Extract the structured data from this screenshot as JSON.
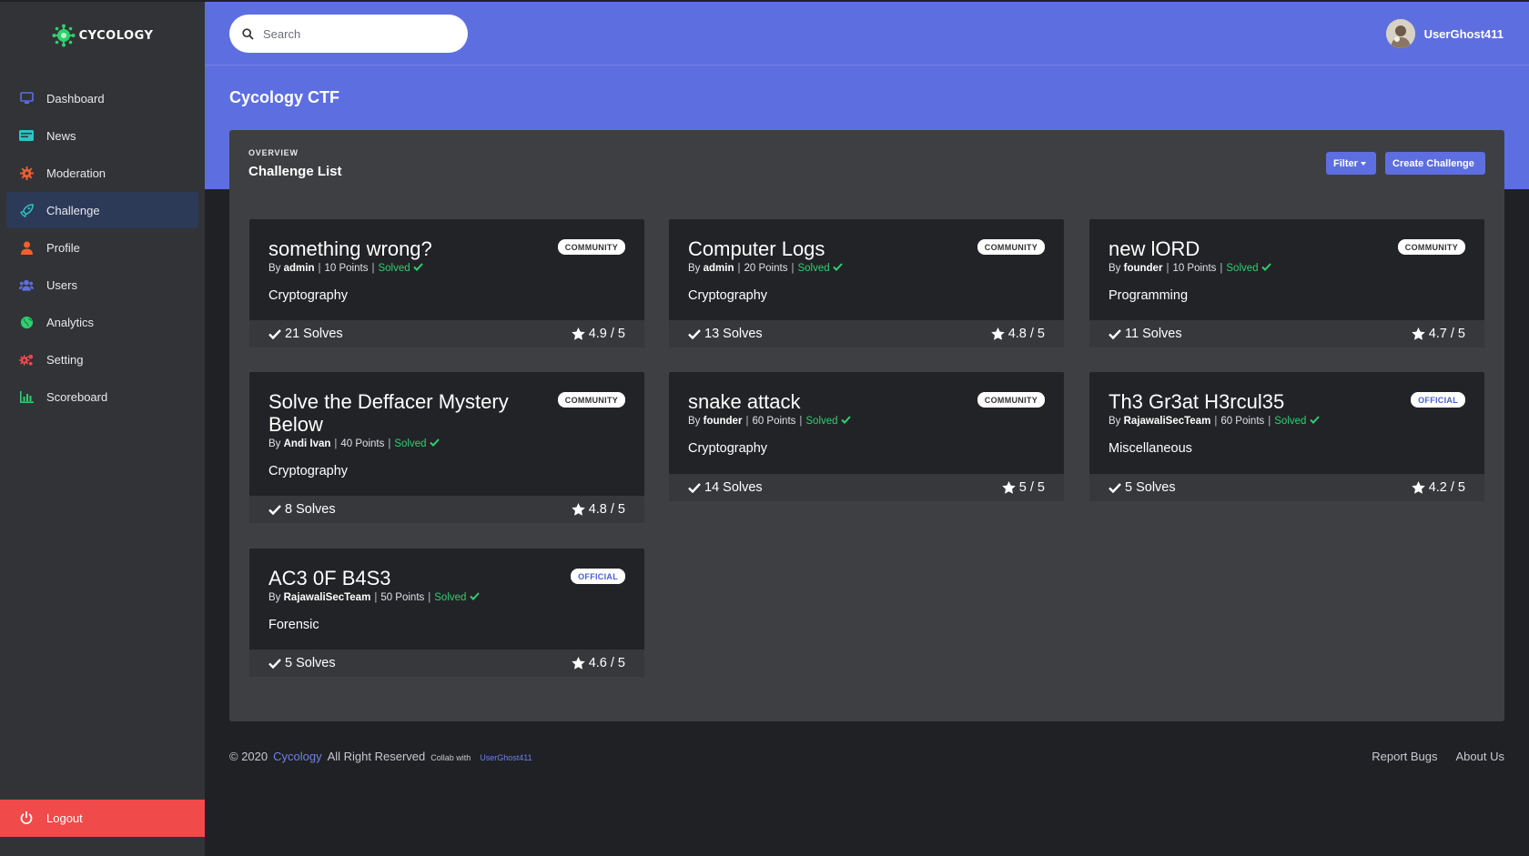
{
  "brand": {
    "name": "CYCOLOGY",
    "accent": "#5d6fe0"
  },
  "sidebar": {
    "items": [
      {
        "label": "Dashboard",
        "icon": "monitor-icon",
        "color": "#5d6fe0"
      },
      {
        "label": "News",
        "icon": "news-icon",
        "color": "#2ec4c4"
      },
      {
        "label": "Moderation",
        "icon": "gear-icon",
        "color": "#f0602e"
      },
      {
        "label": "Challenge",
        "icon": "rocket-icon",
        "color": "#2ec4c4"
      },
      {
        "label": "Profile",
        "icon": "user-icon",
        "color": "#f0602e"
      },
      {
        "label": "Users",
        "icon": "users-icon",
        "color": "#5d6fe0"
      },
      {
        "label": "Analytics",
        "icon": "globe-icon",
        "color": "#2fcf6e"
      },
      {
        "label": "Setting",
        "icon": "gears-icon",
        "color": "#f04a4a"
      },
      {
        "label": "Scoreboard",
        "icon": "bar-chart-icon",
        "color": "#2fcf6e"
      }
    ],
    "active_index": 3,
    "logout_label": "Logout"
  },
  "topbar": {
    "search_placeholder": "Search",
    "username": "UserGhost411"
  },
  "page_title": "Cycology CTF",
  "panel": {
    "overview_label": "OVERVIEW",
    "title": "Challenge List",
    "filter_label": "Filter",
    "create_label": "Create Challenge"
  },
  "challenges": [
    {
      "title": "something wrong?",
      "by_prefix": "By",
      "author": "admin",
      "points": "10 Points",
      "status": "Solved",
      "category": "Cryptography",
      "badge": "COMMUNITY",
      "solves": "21 Solves",
      "rating": "4.9 / 5"
    },
    {
      "title": "Computer Logs",
      "by_prefix": "By",
      "author": "admin",
      "points": "20 Points",
      "status": "Solved",
      "category": "Cryptography",
      "badge": "COMMUNITY",
      "solves": "13 Solves",
      "rating": "4.8 / 5"
    },
    {
      "title": "new lORD",
      "by_prefix": "By",
      "author": "founder",
      "points": "10 Points",
      "status": "Solved",
      "category": "Programming",
      "badge": "COMMUNITY",
      "solves": "11 Solves",
      "rating": "4.7 / 5"
    },
    {
      "title": "Solve the Deffacer Mystery Below",
      "by_prefix": "By",
      "author": "Andi Ivan",
      "points": "40 Points",
      "status": "Solved",
      "category": "Cryptography",
      "badge": "COMMUNITY",
      "solves": "8 Solves",
      "rating": "4.8 / 5"
    },
    {
      "title": "snake attack",
      "by_prefix": "By",
      "author": "founder",
      "points": "60 Points",
      "status": "Solved",
      "category": "Cryptography",
      "badge": "COMMUNITY",
      "solves": "14 Solves",
      "rating": "5 / 5"
    },
    {
      "title": "Th3 Gr3at H3rcul35",
      "by_prefix": "By",
      "author": "RajawaliSecTeam",
      "points": "60 Points",
      "status": "Solved",
      "category": "Miscellaneous",
      "badge": "OFFICIAL",
      "solves": "5 Solves",
      "rating": "4.2 / 5"
    },
    {
      "title": "AC3 0F B4S3",
      "by_prefix": "By",
      "author": "RajawaliSecTeam",
      "points": "50 Points",
      "status": "Solved",
      "category": "Forensic",
      "badge": "OFFICIAL",
      "solves": "5 Solves",
      "rating": "4.6 / 5"
    }
  ],
  "footer": {
    "copyright": "© 2020",
    "brand_link": "Cycology",
    "rights": "All Right Reserved",
    "collab": "Collab with",
    "collab_user": "UserGhost411",
    "links": [
      "Report Bugs",
      "About Us"
    ]
  }
}
